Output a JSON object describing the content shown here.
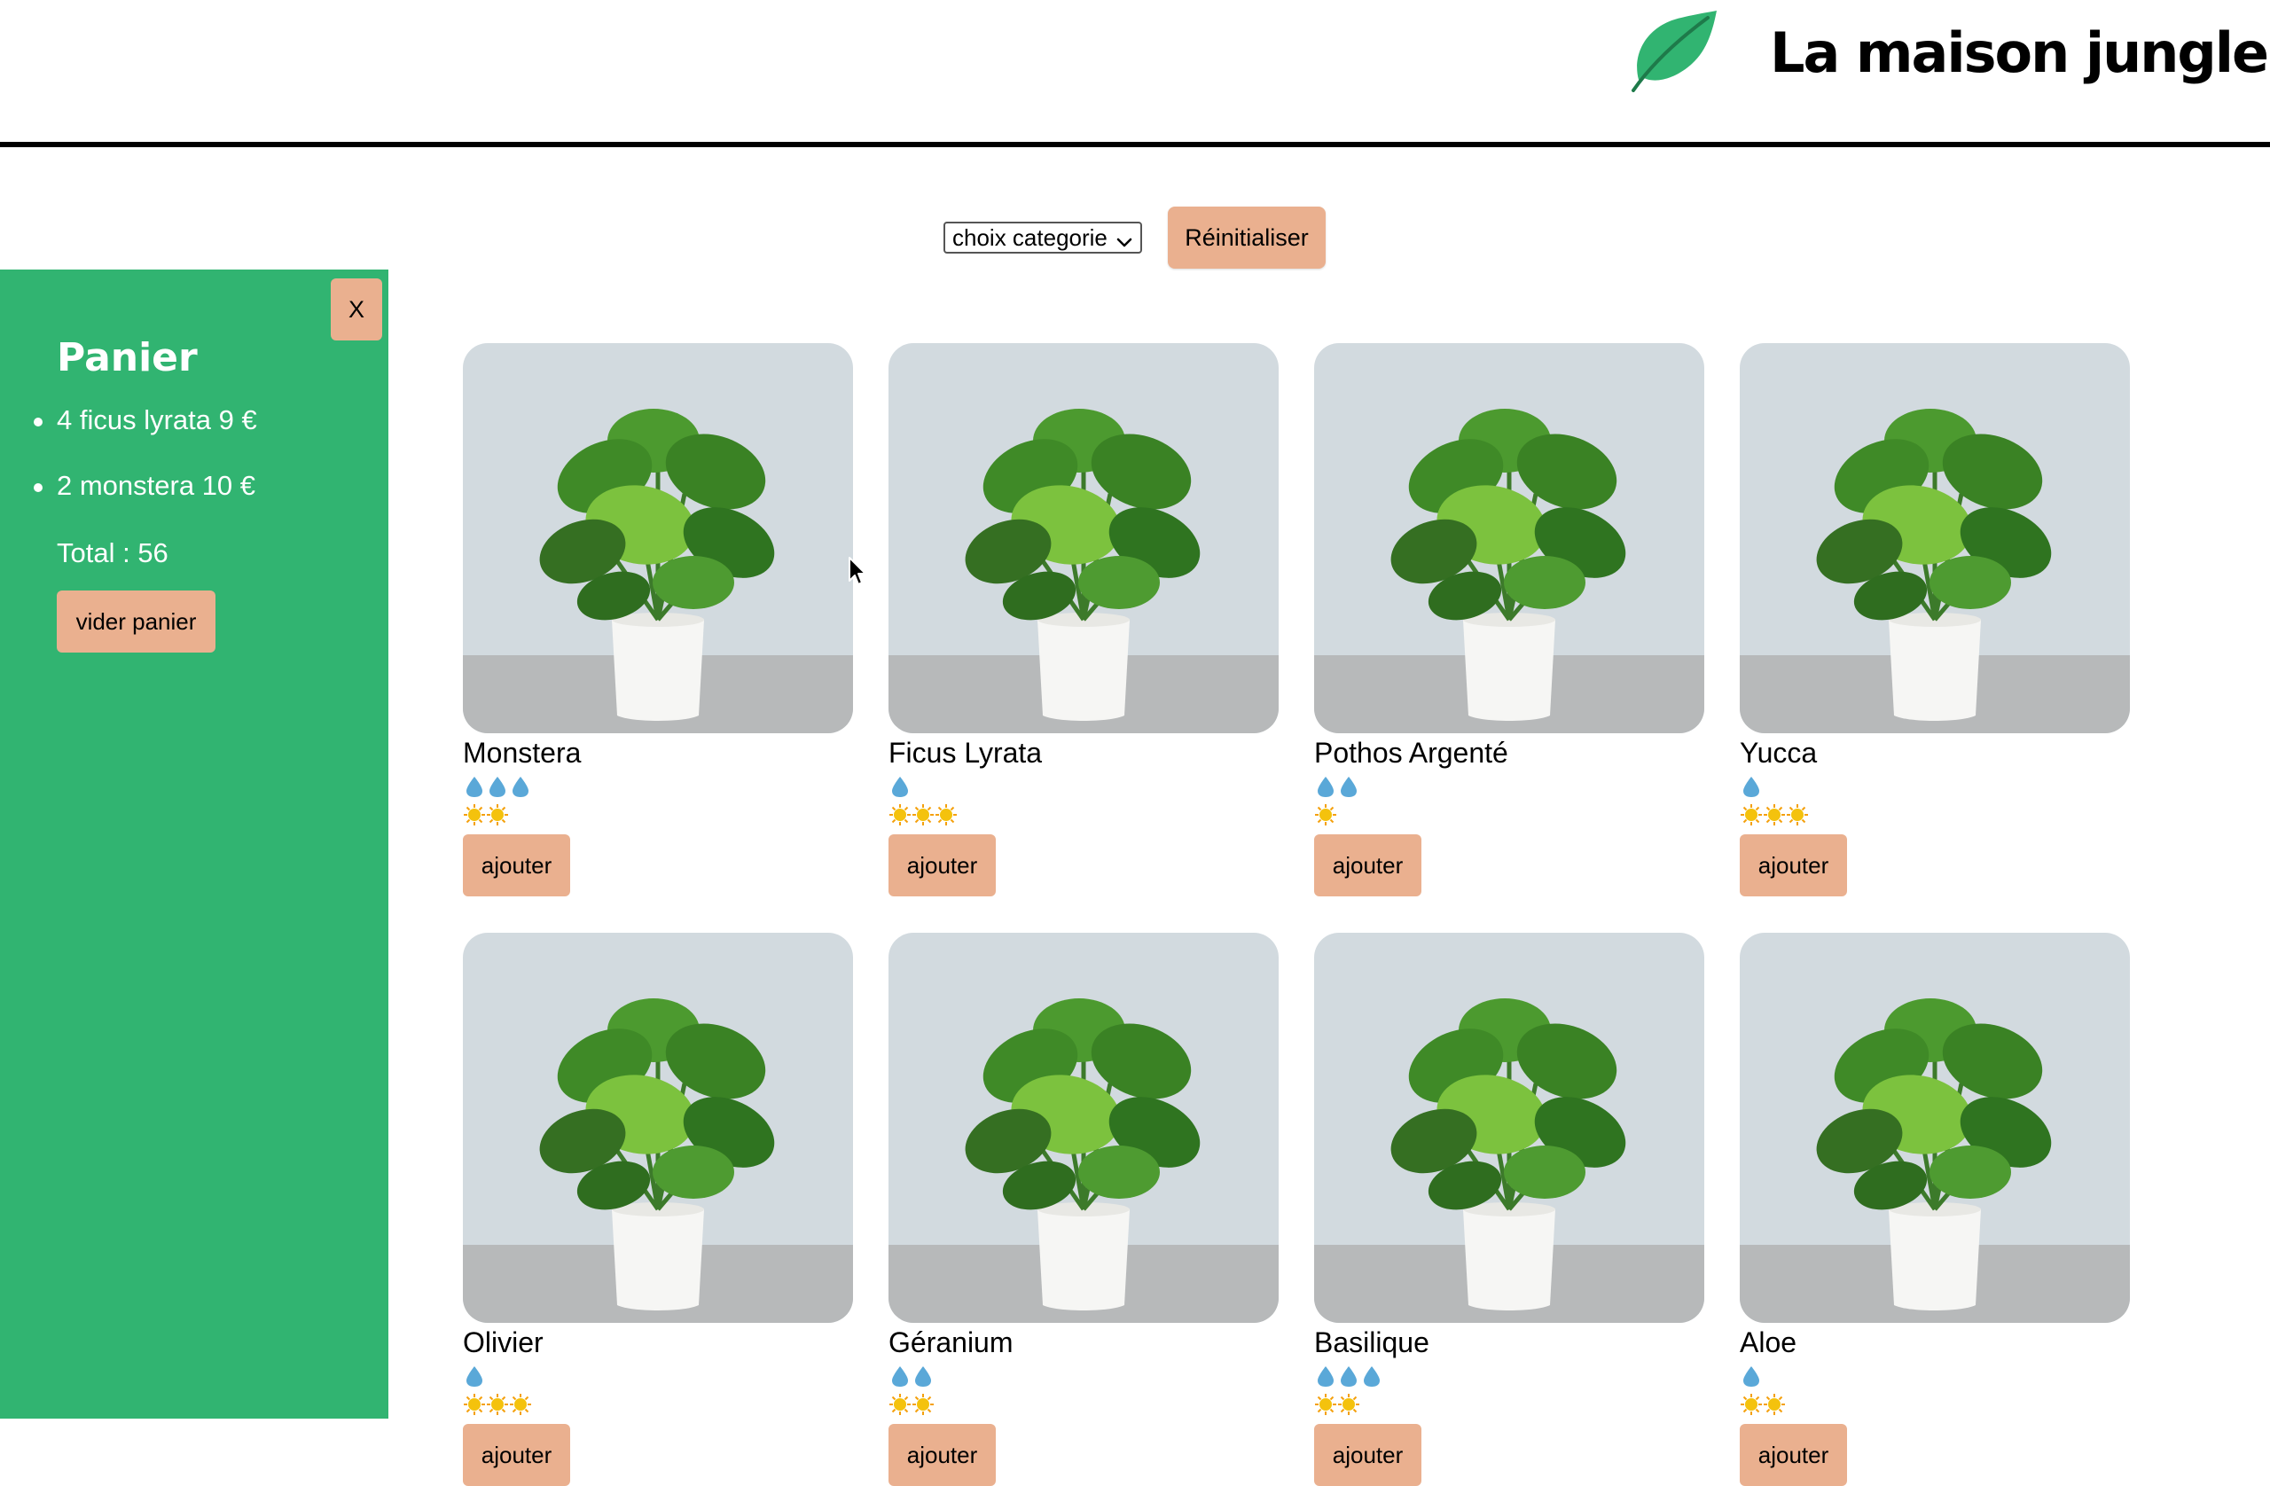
{
  "header": {
    "title": "La maison jungle",
    "logo_icon": "leaf-icon",
    "logo_color": "#31b471"
  },
  "filter": {
    "select_value": "choix categorie",
    "reset_label": "Réinitialiser"
  },
  "cart": {
    "close_label": "X",
    "title": "Panier",
    "items": [
      {
        "label": "4 ficus lyrata 9 €"
      },
      {
        "label": "2 monstera 10 €"
      }
    ],
    "total": "Total : 56",
    "empty_label": "vider panier",
    "background": "#31b471"
  },
  "plants": [
    {
      "name": "Monstera",
      "water": 3,
      "light": 2,
      "add_label": "ajouter"
    },
    {
      "name": "Ficus Lyrata",
      "water": 1,
      "light": 3,
      "add_label": "ajouter"
    },
    {
      "name": "Pothos Argenté",
      "water": 2,
      "light": 1,
      "add_label": "ajouter"
    },
    {
      "name": "Yucca",
      "water": 1,
      "light": 3,
      "add_label": "ajouter"
    },
    {
      "name": "Olivier",
      "water": 1,
      "light": 3,
      "add_label": "ajouter"
    },
    {
      "name": "Géranium",
      "water": 2,
      "light": 2,
      "add_label": "ajouter"
    },
    {
      "name": "Basilique",
      "water": 3,
      "light": 2,
      "add_label": "ajouter"
    },
    {
      "name": "Aloe",
      "water": 1,
      "light": 2,
      "add_label": "ajouter"
    }
  ],
  "icons": {
    "water": "water-drop-icon",
    "light": "sun-icon",
    "button_color": "#eab08f",
    "drop_color": "#5aa8d8",
    "sun_color": "#f4c20d"
  }
}
